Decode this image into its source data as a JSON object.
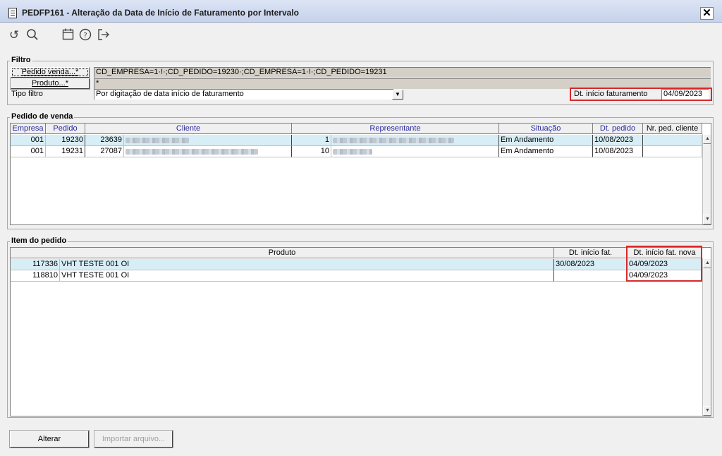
{
  "window": {
    "title": "PEDFP161 - Alteração da Data de Início de Faturamento por Intervalo",
    "close_label": "✕"
  },
  "toolbar": {
    "icons": [
      "undo-icon",
      "search-icon",
      "calendar-icon",
      "help-icon",
      "exit-icon"
    ]
  },
  "filtro": {
    "label": "Filtro",
    "pedido_venda_button": "Pedido venda...*",
    "pedido_venda_value": "CD_EMPRESA=1·!·;CD_PEDIDO=19230·;CD_EMPRESA=1·!·;CD_PEDIDO=19231",
    "produto_button": "Produto...*",
    "produto_value": "*",
    "tipo_filtro_label": "Tipo filtro",
    "tipo_filtro_value": "Por digitação de data início de faturamento",
    "dt_inicio_label": "Dt. início faturamento",
    "dt_inicio_value": "04/09/2023"
  },
  "pedido_venda": {
    "label": "Pedido de venda",
    "columns": [
      "Empresa",
      "Pedido",
      "Cliente",
      "Representante",
      "Situação",
      "Dt. pedido",
      "Nr. ped. cliente"
    ],
    "rows": [
      {
        "empresa": "001",
        "pedido": "19230",
        "cliente_cod": "23639",
        "rep_cod": "1",
        "situacao": "Em Andamento",
        "dt_pedido": "10/08/2023",
        "nr_ped_cliente": ""
      },
      {
        "empresa": "001",
        "pedido": "19231",
        "cliente_cod": "27087",
        "rep_cod": "10",
        "situacao": "Em Andamento",
        "dt_pedido": "10/08/2023",
        "nr_ped_cliente": ""
      }
    ]
  },
  "item_pedido": {
    "label": "Item do pedido",
    "columns": [
      "Produto",
      "Dt. início fat.",
      "Dt. início fat. nova"
    ],
    "rows": [
      {
        "cod": "117336",
        "produto": "VHT TESTE 001 OI",
        "dt_inicio_fat": "30/08/2023",
        "dt_inicio_fat_nova": "04/09/2023"
      },
      {
        "cod": "118810",
        "produto": "VHT TESTE 001 OI",
        "dt_inicio_fat": "",
        "dt_inicio_fat_nova": "04/09/2023"
      }
    ]
  },
  "actions": {
    "alterar": "Alterar",
    "importar": "Importar arquivo..."
  },
  "colors": {
    "header_blue": "#2a2aa0",
    "highlight_red": "#d52a2a",
    "selected_row": "#d8eef7"
  }
}
